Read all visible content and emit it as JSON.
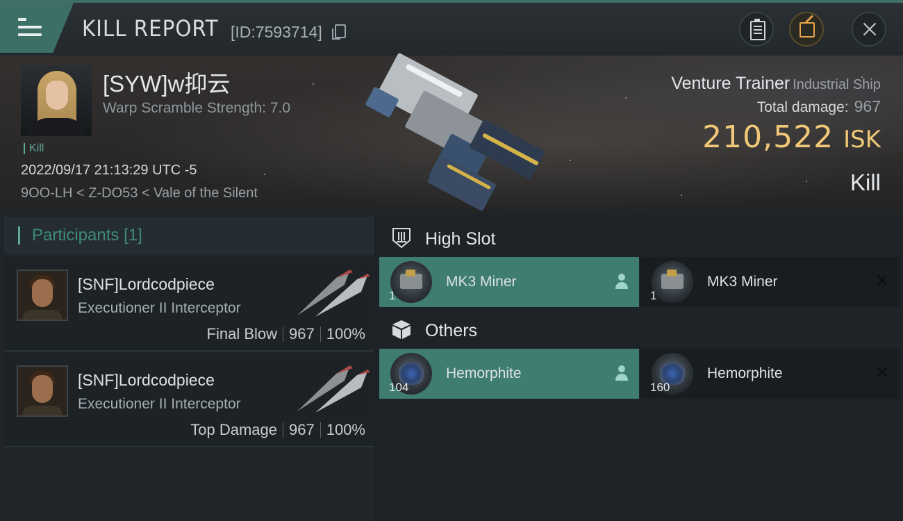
{
  "header": {
    "title": "KILL REPORT",
    "report_id": "[ID:7593714]",
    "icons": {
      "menu": "menu-icon",
      "copy": "copy-icon",
      "clipboard": "clipboard-icon",
      "share": "share-icon",
      "close": "close-icon"
    }
  },
  "victim": {
    "name": "[SYW]w抑云",
    "warp_scramble": "Warp Scramble Strength: 7.0",
    "tag": "Kill",
    "datetime": "2022/09/17 21:13:29 UTC -5",
    "location": "9OO-LH < Z-DO53 < Vale of the Silent",
    "ship_name": "Venture Trainer",
    "ship_class": "Industrial Ship",
    "total_damage_label": "Total damage:",
    "total_damage": "967",
    "isk_value": "210,522",
    "isk_unit": "ISK",
    "kill_type": "Kill"
  },
  "participants": {
    "title": "Participants",
    "count": "[1]",
    "items": [
      {
        "name": "[SNF]Lordcodpiece",
        "ship": "Executioner II Interceptor",
        "role": "Final Blow",
        "damage": "967",
        "percent": "100%"
      },
      {
        "name": "[SNF]Lordcodpiece",
        "ship": "Executioner II Interceptor",
        "role": "Top Damage",
        "damage": "967",
        "percent": "100%"
      }
    ]
  },
  "fittings": {
    "high_slot": {
      "title": "High Slot",
      "icon": "turret-slot-icon",
      "items": [
        {
          "name": "MK3 Miner",
          "qty": "1",
          "state": "dropped"
        },
        {
          "name": "MK3 Miner",
          "qty": "1",
          "state": "destroyed"
        }
      ]
    },
    "others": {
      "title": "Others",
      "icon": "cargo-box-icon",
      "items": [
        {
          "name": "Hemorphite",
          "qty": "104",
          "state": "dropped"
        },
        {
          "name": "Hemorphite",
          "qty": "160",
          "state": "destroyed"
        }
      ]
    }
  },
  "colors": {
    "accent": "#3f7c71",
    "isk": "#f0c878",
    "background": "#1b2024"
  }
}
